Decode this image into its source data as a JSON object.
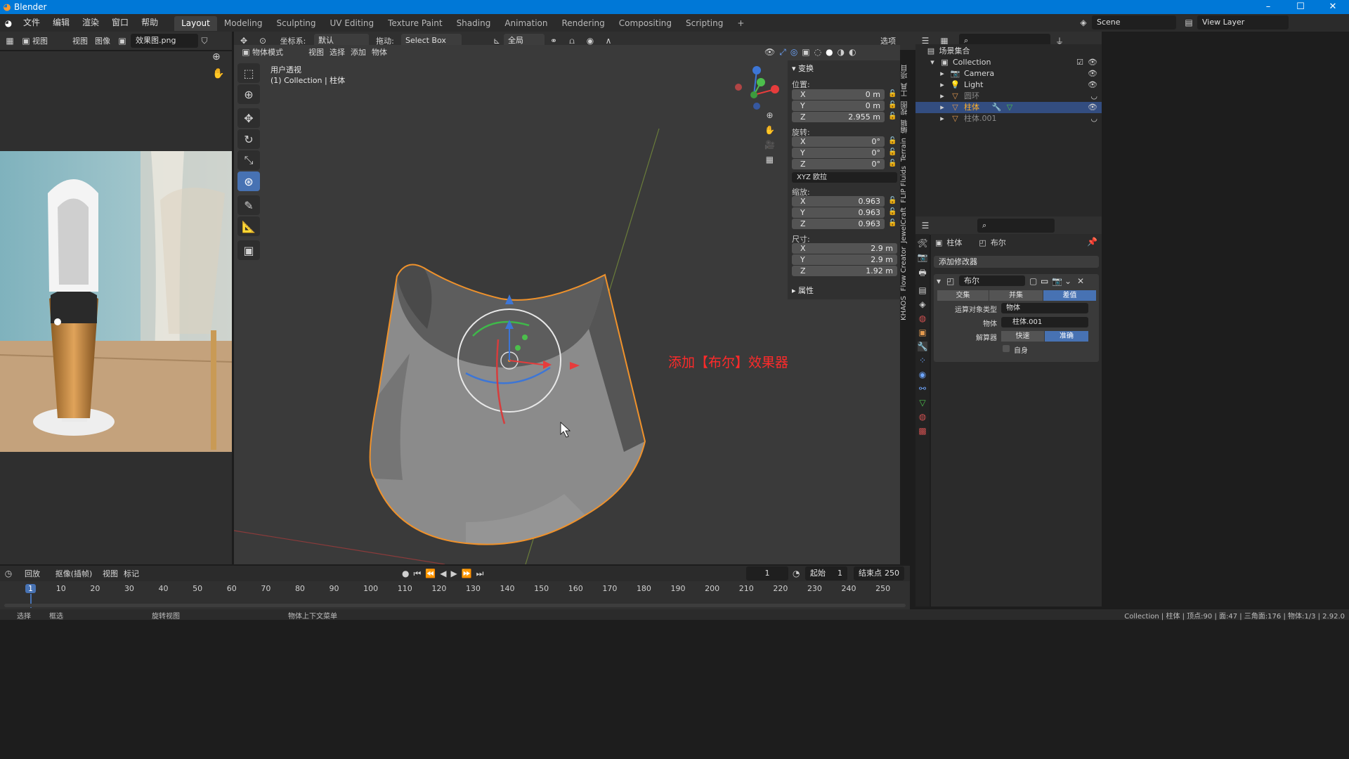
{
  "app": {
    "title": "Blender",
    "logo_icon": "blender-logo-icon"
  },
  "window_controls": [
    "–",
    "☐",
    "✕"
  ],
  "menus": [
    "文件",
    "编辑",
    "渲染",
    "窗口",
    "帮助"
  ],
  "workspaces": [
    "Layout",
    "Modeling",
    "Sculpting",
    "UV Editing",
    "Texture Paint",
    "Shading",
    "Animation",
    "Rendering",
    "Compositing",
    "Scripting"
  ],
  "active_workspace": "Layout",
  "scene": {
    "name": "Scene",
    "view_layer": "View Layer"
  },
  "image_editor": {
    "view_menu": "视图",
    "menus": [
      "视图",
      "图像"
    ],
    "image_name": "效果图.png"
  },
  "viewport_header": {
    "transform_label": "坐标系:",
    "orientation": "默认",
    "drag_label": "拖动:",
    "drag_mode": "Select Box",
    "pivot": "全局",
    "select_label": "选项",
    "mode": "物体模式",
    "menus": [
      "视图",
      "选择",
      "添加",
      "物体"
    ]
  },
  "viewport": {
    "perspective": "用户透视",
    "context": "(1) Collection | 柱体",
    "annotation": "添加【布尔】效果器",
    "annotation_color": "#ff2a2a",
    "selection_color": "#f0922b"
  },
  "npanel": {
    "section": "变换",
    "location_label": "位置:",
    "location": [
      {
        "axis": "X",
        "value": "0 m"
      },
      {
        "axis": "Y",
        "value": "0 m"
      },
      {
        "axis": "Z",
        "value": "2.955 m"
      }
    ],
    "rotation_label": "旋转:",
    "rotation": [
      {
        "axis": "X",
        "value": "0°"
      },
      {
        "axis": "Y",
        "value": "0°"
      },
      {
        "axis": "Z",
        "value": "0°"
      }
    ],
    "rotation_mode": "XYZ 欧拉",
    "scale_label": "缩放:",
    "scale": [
      {
        "axis": "X",
        "value": "0.963"
      },
      {
        "axis": "Y",
        "value": "0.963"
      },
      {
        "axis": "Z",
        "value": "0.963"
      }
    ],
    "dimensions_label": "尺寸:",
    "dimensions": [
      {
        "axis": "X",
        "value": "2.9 m"
      },
      {
        "axis": "Y",
        "value": "2.9 m"
      },
      {
        "axis": "Z",
        "value": "1.92 m"
      }
    ],
    "properties_section": "属性"
  },
  "side_tabs": [
    "项目",
    "工具",
    "视图",
    "编辑",
    "Terrain",
    "FLIP Fluids",
    "JewelCraft",
    "Flow Creator",
    "KHAOS"
  ],
  "outliner": {
    "root": "场景集合",
    "collection": "Collection",
    "items": [
      {
        "name": "Camera",
        "icon": "camera-icon"
      },
      {
        "name": "Light",
        "icon": "light-icon"
      },
      {
        "name": "圆环",
        "icon": "mesh-icon"
      },
      {
        "name": "柱体",
        "icon": "mesh-icon",
        "selected": true
      },
      {
        "name": "柱体.001",
        "icon": "mesh-icon"
      }
    ]
  },
  "properties": {
    "object_name": "柱体",
    "modifier_tab_name": "布尔",
    "add_modifier": "添加修改器",
    "modifier_name": "布尔",
    "operations": [
      "交集",
      "并集",
      "差值"
    ],
    "active_operation": "差值",
    "operand_label": "运算对象类型",
    "operand_type": "物体",
    "object_label": "物体",
    "object_value": "柱体.001",
    "solver_label": "解算器",
    "solvers": [
      "快速",
      "准确"
    ],
    "active_solver": "准确",
    "self_label": "自身"
  },
  "timeline": {
    "menus": [
      "回放",
      "抠像(插帧)",
      "视图",
      "标记"
    ],
    "current_frame": "1",
    "start_label": "起始",
    "start": "1",
    "end_label": "结束点",
    "end": "250",
    "ticks": [
      "1",
      "10",
      "20",
      "30",
      "40",
      "50",
      "60",
      "70",
      "80",
      "90",
      "100",
      "110",
      "120",
      "130",
      "140",
      "150",
      "160",
      "170",
      "180",
      "190",
      "200",
      "210",
      "220",
      "230",
      "240",
      "250"
    ]
  },
  "statusbar": {
    "items": [
      "选择",
      "框选",
      "旋转视图",
      "物体上下文菜单"
    ],
    "right": "Collection | 柱体 | 顶点:90 | 面:47 | 三角面:176 | 物体:1/3 | 2.92.0"
  }
}
